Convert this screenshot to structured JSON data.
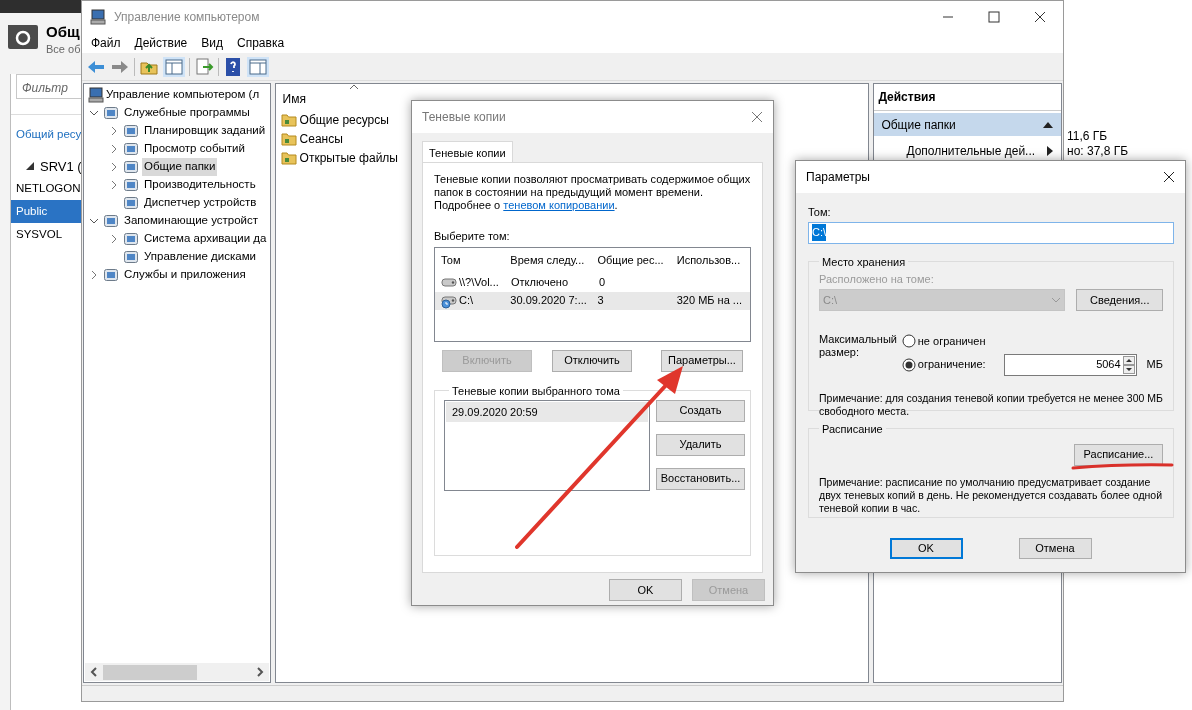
{
  "background_app": {
    "title": "Общ",
    "subtitle": "Все об",
    "filter": {
      "placeholder": "Фильтр"
    },
    "link": "Общий ресу",
    "server": {
      "label": "SRV1 (",
      "expanded": true
    },
    "shares": [
      {
        "label": "NETLOGON",
        "selected": false
      },
      {
        "label": "Public",
        "selected": true
      },
      {
        "label": "SYSVOL",
        "selected": false
      }
    ],
    "disk_info": [
      "11,6 ГБ",
      "но: 37,8 ГБ"
    ]
  },
  "window": {
    "title": "Управление компьютером",
    "menu": [
      "Файл",
      "Действие",
      "Вид",
      "Справка"
    ]
  },
  "tree": {
    "root": "Управление компьютером (л",
    "items": [
      {
        "label": "Служебные программы",
        "expanded": true,
        "selected": false,
        "children": [
          {
            "label": "Планировщик заданий",
            "expanded": false,
            "selected": false
          },
          {
            "label": "Просмотр событий",
            "expanded": false,
            "selected": false
          },
          {
            "label": "Общие папки",
            "expanded": false,
            "selected": true
          },
          {
            "label": "Производительность",
            "expanded": false,
            "selected": false
          },
          {
            "label": "Диспетчер устройств",
            "selected": false
          }
        ]
      },
      {
        "label": "Запоминающие устройст",
        "expanded": true,
        "selected": false,
        "children": [
          {
            "label": "Система архивации да",
            "expanded": false,
            "selected": false
          },
          {
            "label": "Управление дисками",
            "selected": false
          }
        ]
      },
      {
        "label": "Службы и приложения",
        "expanded": false,
        "selected": false
      }
    ]
  },
  "content": {
    "column": "Имя",
    "items": [
      "Общие ресурсы",
      "Сеансы",
      "Открытые файлы"
    ]
  },
  "actions": {
    "header": "Действия",
    "section": {
      "label": "Общие папки",
      "expanded": true
    },
    "items": [
      "Дополнительные дей..."
    ]
  },
  "shadow_dialog": {
    "title": "Теневые копии",
    "tabs": [
      {
        "label": "Теневые копии",
        "selected": true
      }
    ],
    "intro": "Теневые копии позволяют просматривать содержимое общих папок в состоянии на предыдущий момент времени.",
    "more_prefix": "Подробнее о ",
    "link": "теневом копировании",
    "link_suffix": ".",
    "volume_label": "Выберите том:",
    "columns": [
      "Том",
      "Время следу...",
      "Общие рес...",
      "Использов..."
    ],
    "rows": [
      {
        "cells": [
          "\\\\?\\Vol...",
          "Отключено",
          "0"
        ],
        "selected": false
      },
      {
        "cells": [
          "C:\\",
          "30.09.2020 7:...",
          "3",
          "320 МБ на ..."
        ],
        "selected": true
      }
    ],
    "buttons": [
      {
        "label": "Включить",
        "disabled": true
      },
      {
        "label": "Отключить",
        "disabled": false
      },
      {
        "label": "Параметры...",
        "disabled": false
      }
    ],
    "copies_group": "Теневые копии выбранного тома",
    "copies": [
      {
        "label": "29.09.2020 20:59",
        "selected": true
      }
    ],
    "copy_buttons": [
      "Создать",
      "Удалить",
      "Восстановить..."
    ],
    "footer": [
      {
        "label": "OK",
        "disabled": false
      },
      {
        "label": "Отмена",
        "disabled": true
      }
    ]
  },
  "params_dialog": {
    "title": "Параметры",
    "volume_label": "Том:",
    "volume": {
      "value": "C:\\",
      "text_selected": true
    },
    "storage_group": "Место хранения",
    "location_label": "Расположено на томе:",
    "location": {
      "value": "C:\\",
      "disabled": true
    },
    "details_button": "Сведения...",
    "max_size_label": "Максимальный размер:",
    "options": [
      {
        "label": "не ограничен",
        "selected": false
      },
      {
        "label": "ограничение:",
        "selected": true
      }
    ],
    "size_value": "5064",
    "size_unit": "МБ",
    "size_note": "Примечание: для создания теневой копии требуется не менее 300 МБ свободного места.",
    "schedule_group": "Расписание",
    "schedule_button": "Расписание...",
    "schedule_note": "Примечание: расписание по умолчанию предусматривает создание двух теневых копий в день. Не рекомендуется создавать более одной теневой копии в час.",
    "footer": [
      {
        "label": "OK",
        "default": true
      },
      {
        "label": "Отмена",
        "default": false
      }
    ]
  }
}
